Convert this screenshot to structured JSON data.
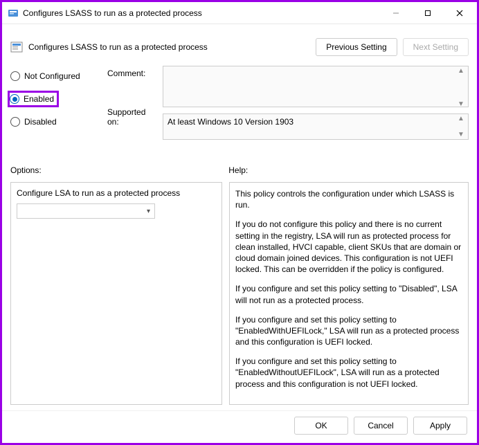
{
  "titlebar": {
    "title": "Configures LSASS to run as a protected process"
  },
  "header": {
    "setting_name": "Configures LSASS to run as a protected process",
    "prev_btn": "Previous Setting",
    "next_btn": "Next Setting"
  },
  "state": {
    "not_configured": "Not Configured",
    "enabled": "Enabled",
    "disabled": "Disabled",
    "selected": "Enabled"
  },
  "labels": {
    "comment": "Comment:",
    "supported": "Supported on:",
    "options": "Options:",
    "help": "Help:"
  },
  "supported_on": "At least Windows 10 Version 1903",
  "options": {
    "title": "Configure LSA to run as a protected process"
  },
  "help": {
    "p1": "This policy controls the configuration under which LSASS is run.",
    "p2": "If you do not configure this policy and there is no current setting in the registry, LSA will run as protected process for clean installed, HVCI capable, client SKUs that are domain or cloud domain joined devices. This configuration is not UEFI locked. This can be overridden if the policy is configured.",
    "p3": "If you configure and set this policy setting to \"Disabled\", LSA will not run as a protected process.",
    "p4": "If you configure and set this policy setting to \"EnabledWithUEFILock,\" LSA will run as a protected process and this configuration is UEFI locked.",
    "p5": "If you configure and set this policy setting to \"EnabledWithoutUEFILock\", LSA will run as a protected process and this configuration is not UEFI locked."
  },
  "footer": {
    "ok": "OK",
    "cancel": "Cancel",
    "apply": "Apply"
  }
}
